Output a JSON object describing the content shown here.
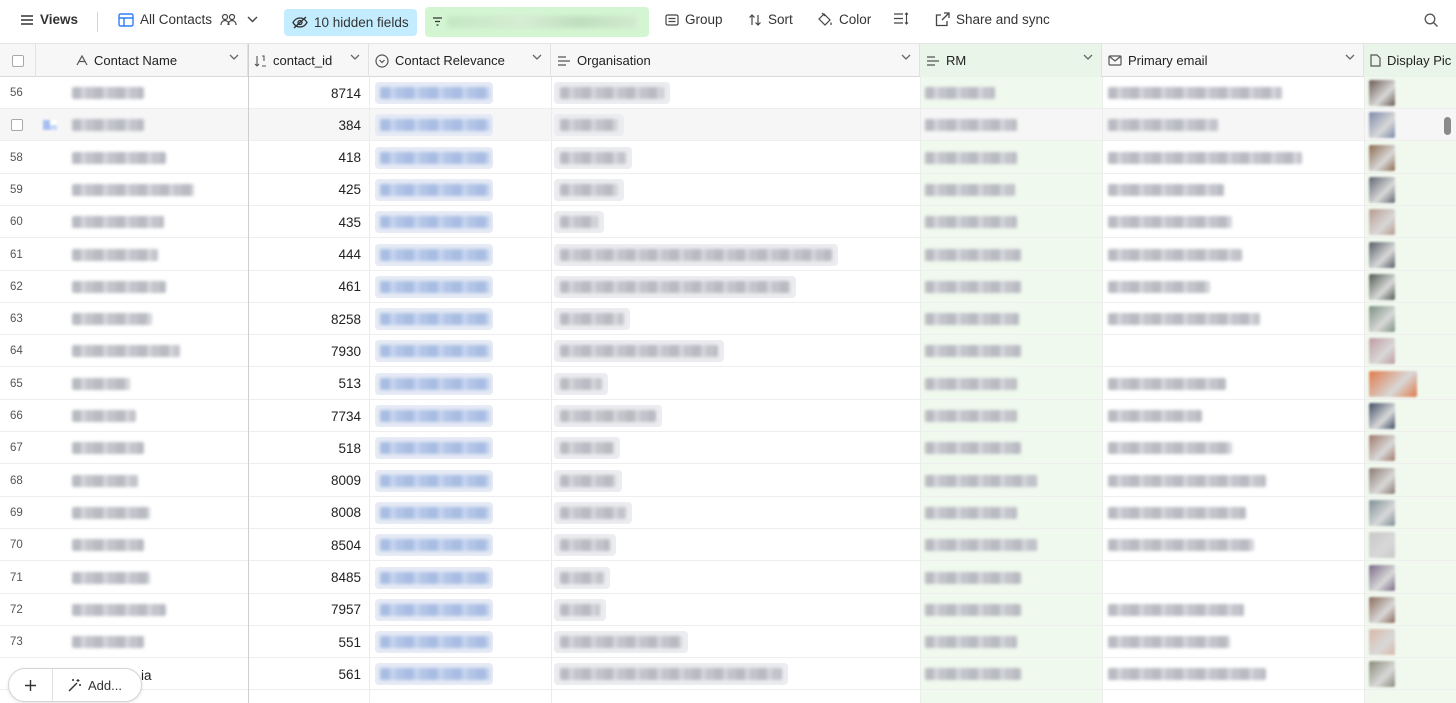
{
  "toolbar": {
    "views_label": "Views",
    "view_name": "All Contacts",
    "hidden_fields_label": "10 hidden fields",
    "group_label": "Group",
    "sort_label": "Sort",
    "color_label": "Color",
    "share_label": "Share and sync"
  },
  "columns": [
    {
      "name": "Contact Name"
    },
    {
      "name": "contact_id"
    },
    {
      "name": "Contact Relevance"
    },
    {
      "name": "Organisation"
    },
    {
      "name": "RM"
    },
    {
      "name": "Primary email"
    },
    {
      "name": "Display Pic"
    }
  ],
  "rows": [
    {
      "num": "56",
      "contact_id": "8714"
    },
    {
      "num": "",
      "contact_id": "384"
    },
    {
      "num": "58",
      "contact_id": "418"
    },
    {
      "num": "59",
      "contact_id": "425"
    },
    {
      "num": "60",
      "contact_id": "435"
    },
    {
      "num": "61",
      "contact_id": "444"
    },
    {
      "num": "62",
      "contact_id": "461"
    },
    {
      "num": "63",
      "contact_id": "8258"
    },
    {
      "num": "64",
      "contact_id": "7930"
    },
    {
      "num": "65",
      "contact_id": "513"
    },
    {
      "num": "66",
      "contact_id": "7734"
    },
    {
      "num": "67",
      "contact_id": "518"
    },
    {
      "num": "68",
      "contact_id": "8009"
    },
    {
      "num": "69",
      "contact_id": "8008"
    },
    {
      "num": "70",
      "contact_id": "8504"
    },
    {
      "num": "71",
      "contact_id": "8485"
    },
    {
      "num": "72",
      "contact_id": "7957"
    },
    {
      "num": "73",
      "contact_id": "551"
    },
    {
      "num": "",
      "contact_id": "561"
    }
  ],
  "footer": {
    "add_label": "Add...",
    "name_fragment": "ia"
  },
  "colors": {
    "hidden_fields_bg": "#c4ecff",
    "filter_bg": "#d4f5d2",
    "rm_column_bg": "#f0f9ee"
  },
  "icons": {
    "views": "hamburger-icon",
    "view": "grid-view-icon",
    "collaborators": "people-icon",
    "hidden": "eye-slash-icon",
    "filter": "filter-icon",
    "group": "group-icon",
    "sort": "sort-icon",
    "color": "paint-bucket-icon",
    "row_height": "row-height-icon",
    "share": "share-icon",
    "search": "search-icon"
  }
}
